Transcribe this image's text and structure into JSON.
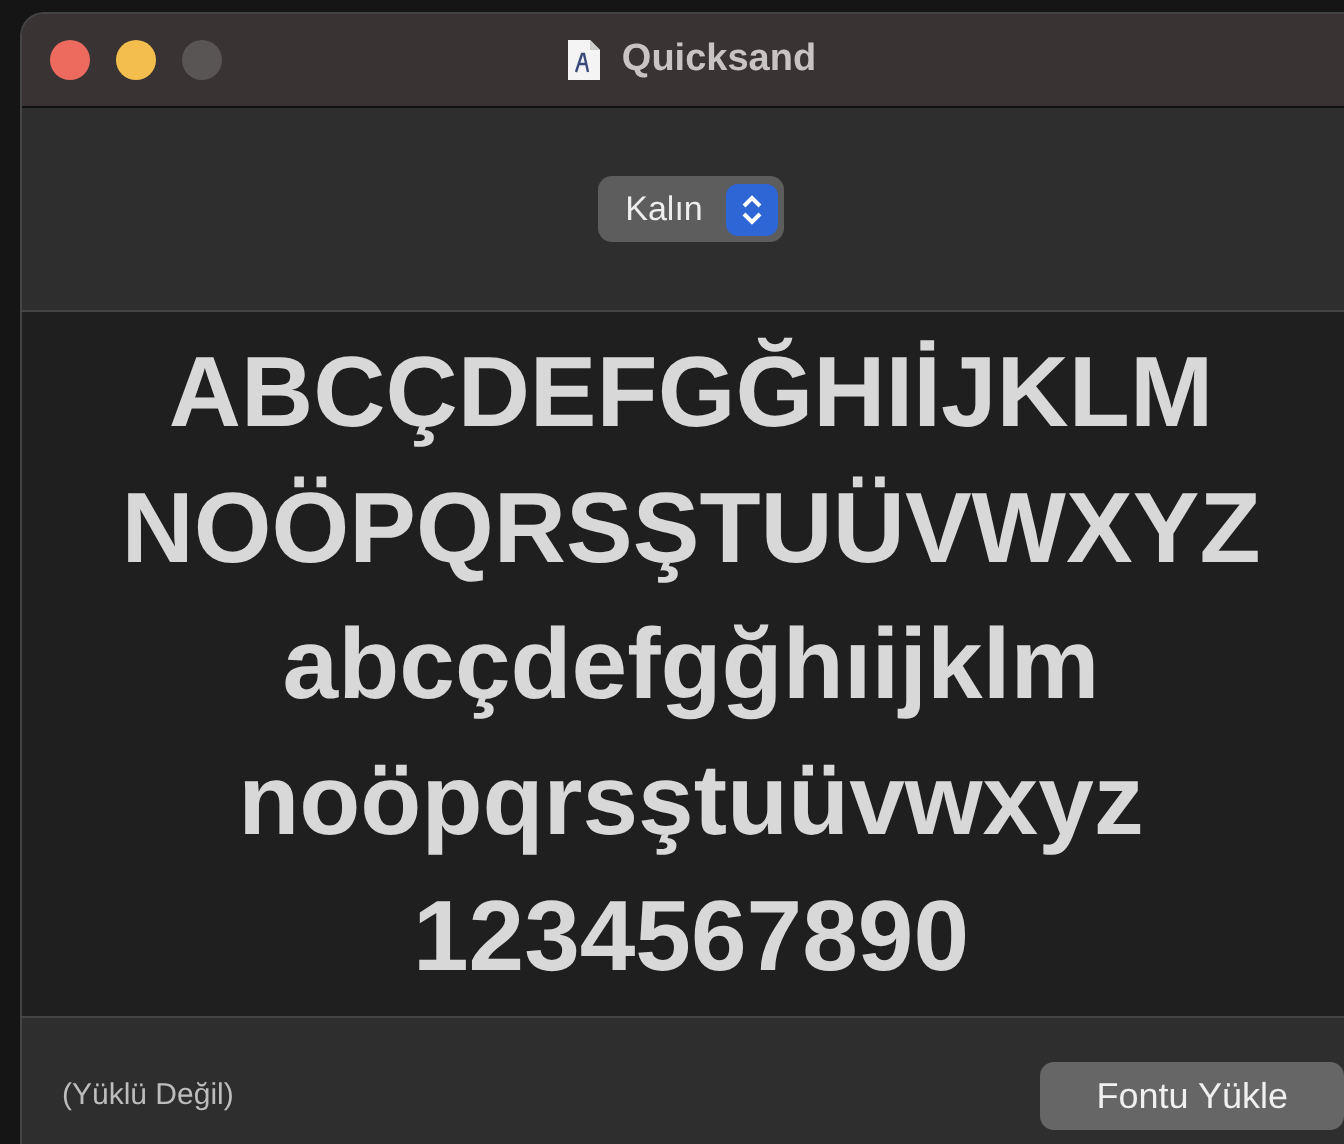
{
  "window": {
    "title": "Quicksand"
  },
  "style_popup": {
    "value": "Kalın"
  },
  "sample_lines": [
    "ABCÇDEFGĞHIİJKLM",
    "NOÖPQRSŞTUÜVWXYZ",
    "abcçdefgğhıijklm",
    "noöpqrsştuüvwxyz",
    "1234567890"
  ],
  "status": "(Yüklü Değil)",
  "install_button": {
    "label": "Fontu Yükle"
  }
}
